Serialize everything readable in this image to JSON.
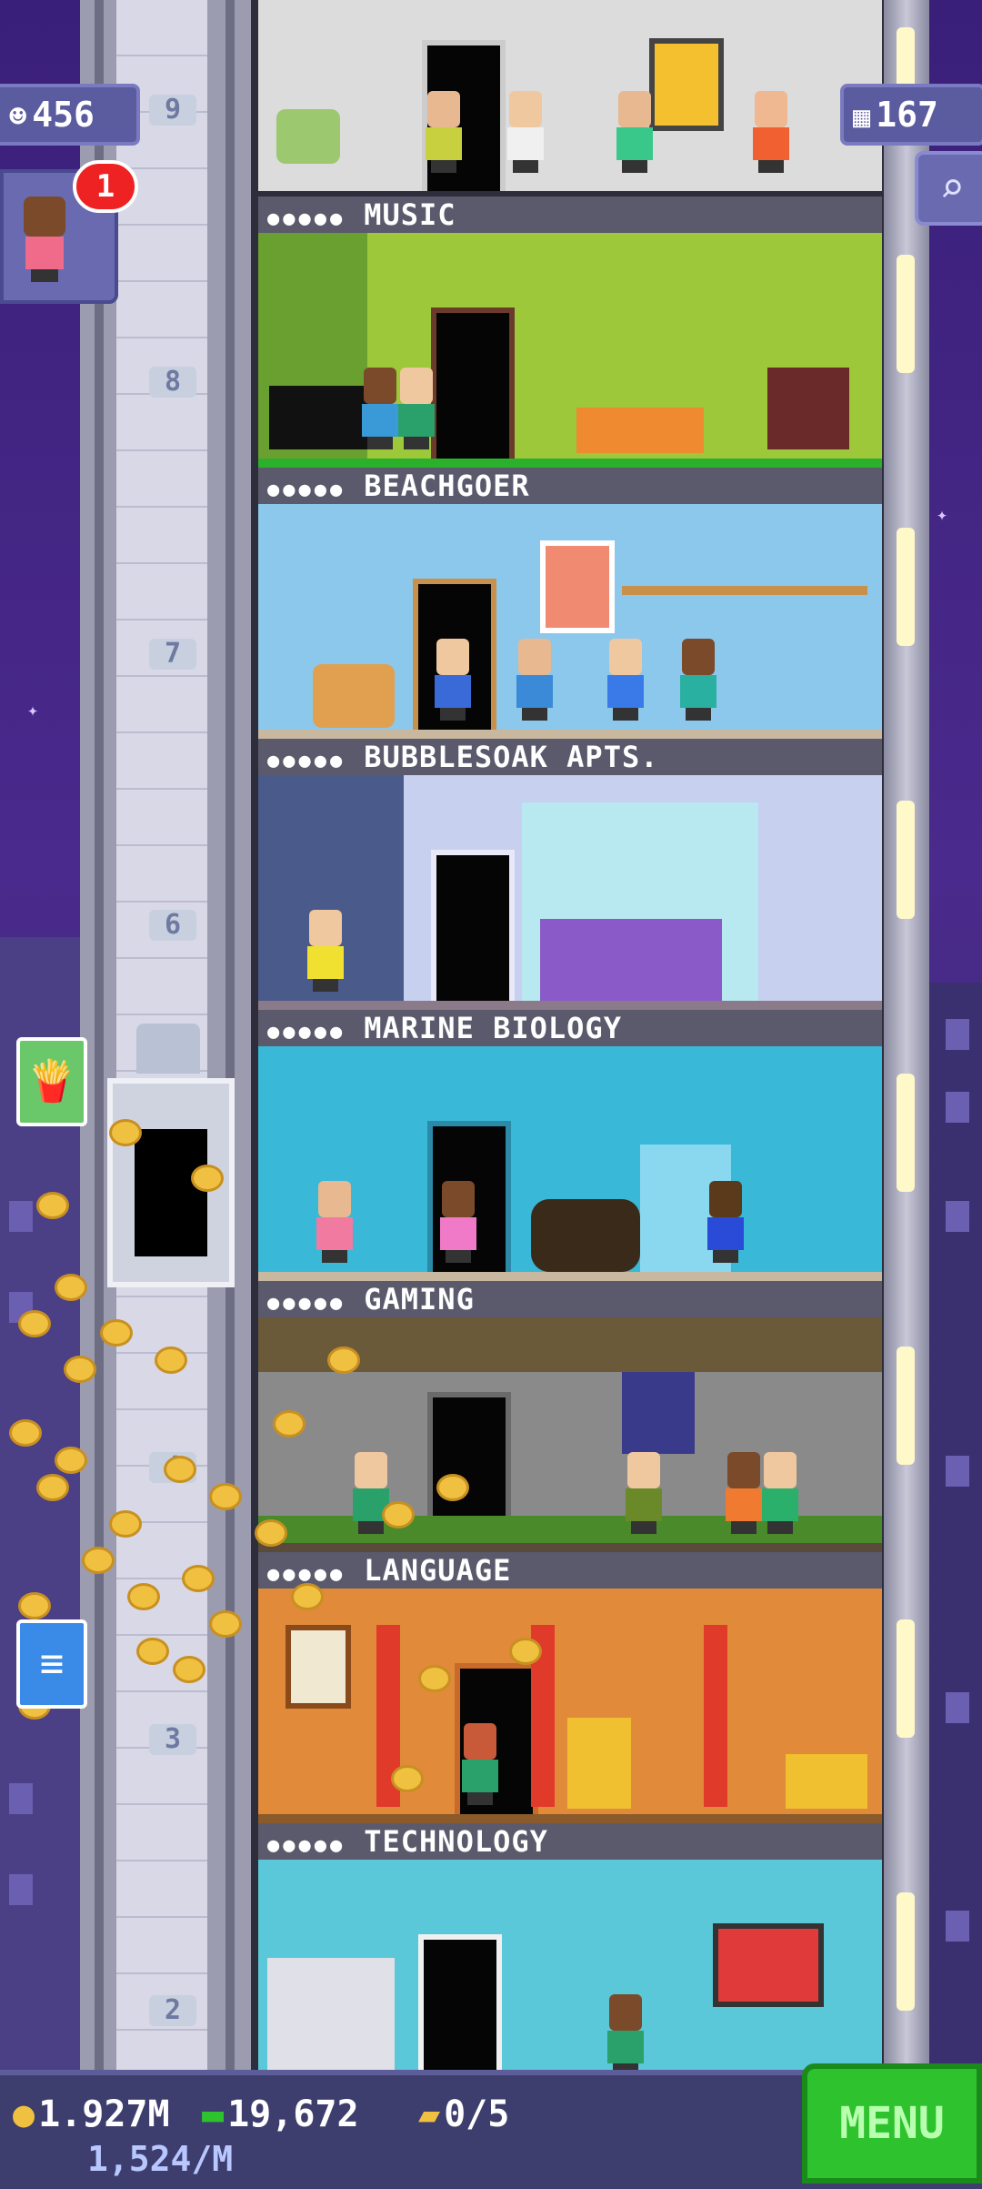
{
  "header": {
    "population": "456",
    "floors": "167",
    "visitor_badge": "1"
  },
  "elevator": {
    "floor_numbers": [
      "9",
      "8",
      "7",
      "6",
      "4",
      "3",
      "2"
    ]
  },
  "floors": [
    {
      "name": "",
      "wall": "#d8d8d8"
    },
    {
      "name": "MUSIC",
      "wall": "#9cc83a"
    },
    {
      "name": "BEACHGOER",
      "wall": "#8cc8ec"
    },
    {
      "name": "BUBBLESOAK APTS.",
      "wall": "#a8b8e8"
    },
    {
      "name": "MARINE BIOLOGY",
      "wall": "#3ab8d8"
    },
    {
      "name": "GAMING",
      "wall": "#8a8a8a"
    },
    {
      "name": "LANGUAGE",
      "wall": "#e08a3a"
    },
    {
      "name": "TECHNOLOGY",
      "wall": "#5ac8d8"
    }
  ],
  "stars_label": "●●●●●",
  "bottom": {
    "coins": "1.927M",
    "bux": "19,672",
    "tickets": "0/5",
    "rate": "1,524/M",
    "menu": "MENU"
  },
  "colors": {
    "accent": "#2ec22e",
    "badge": "#ee2222",
    "bar": "#3e3e6e"
  }
}
